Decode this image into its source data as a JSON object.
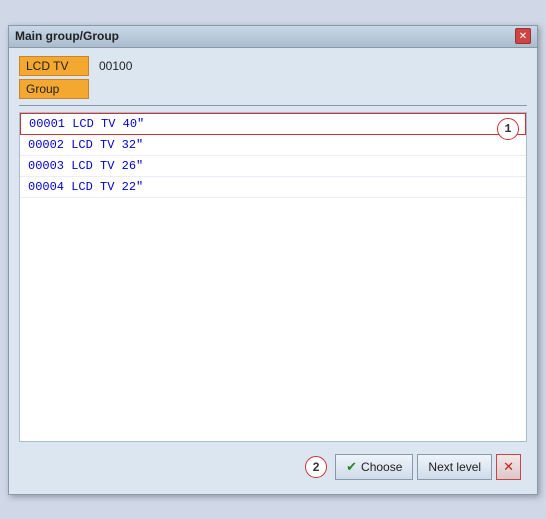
{
  "window": {
    "title": "Main group/Group",
    "close_label": "✕"
  },
  "fields": [
    {
      "label": "LCD TV",
      "value": "00100"
    },
    {
      "label": "Group",
      "value": ""
    }
  ],
  "list": {
    "items": [
      {
        "id": "00001",
        "name": "LCD TV 40\""
      },
      {
        "id": "00002",
        "name": "LCD TV 32\""
      },
      {
        "id": "00003",
        "name": "LCD TV 26\""
      },
      {
        "id": "00004",
        "name": "LCD TV 22\""
      }
    ],
    "selected_index": 0
  },
  "step1_badge": "1",
  "step2_badge": "2",
  "buttons": {
    "choose": "Choose",
    "next_level": "Next level",
    "cancel": "✕",
    "check": "✔"
  }
}
